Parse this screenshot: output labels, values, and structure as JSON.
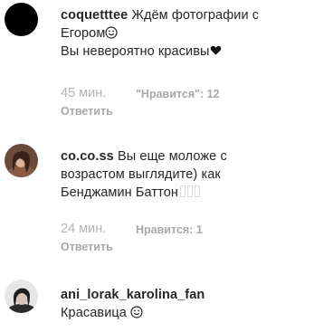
{
  "comments": [
    {
      "username": "coquetttee",
      "text_line1": "Ждём фотографии с",
      "text_line2": "Егором",
      "text_line3": "Вы невероятно красивы",
      "time": "45 мин.",
      "likes": "\"Нравится\": 12",
      "reply": "Ответить",
      "avatar_color": "#000000"
    },
    {
      "username": "co.co.ss",
      "text_line1": "Вы еще моложе с",
      "text_line2": "возрастом выглядите) как",
      "text_line3": "Бенджамин Баттон",
      "time": "24 мин.",
      "likes": "Нравится: 1",
      "reply": "Ответить"
    },
    {
      "username": "ani_lorak_karolina_fan",
      "text_line1": "Красавица"
    }
  ],
  "colors": {
    "primary_text": "#262626",
    "secondary_text": "#a8a8a8"
  },
  "icons": [
    "smiley-emoji-icon",
    "black-heart-icon",
    "unsupported-glyph-icon"
  ]
}
